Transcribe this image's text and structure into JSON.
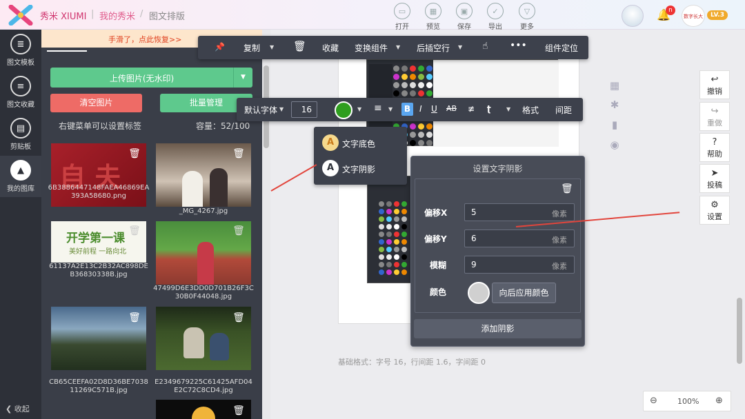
{
  "header": {
    "brand": "秀米 XIUMI",
    "breadcrumb": [
      "我的秀米",
      "图文排版"
    ],
    "toolbar": [
      {
        "label": "打开",
        "icon": "folder-icon"
      },
      {
        "label": "预览",
        "icon": "preview-icon"
      },
      {
        "label": "保存",
        "icon": "save-icon"
      },
      {
        "label": "导出",
        "icon": "export-icon"
      },
      {
        "label": "更多",
        "icon": "more-icon"
      }
    ],
    "notification_count": "n",
    "badge_text": "数字长大",
    "level": "LV.3"
  },
  "leftnav": {
    "items": [
      {
        "label": "图文模板",
        "icon": "template-icon"
      },
      {
        "label": "图文收藏",
        "icon": "favorites-icon"
      },
      {
        "label": "剪贴板",
        "icon": "clipboard-icon"
      },
      {
        "label": "我的图库",
        "icon": "gallery-icon"
      }
    ],
    "collapse": "收起",
    "collapse_arrow": "❮"
  },
  "panel": {
    "hint": "手滑了，点此恢复>>",
    "upload_label": "上传图片(无水印)",
    "clear_label": "清空图片",
    "batch_label": "批量管理",
    "tip": "右键菜单可以设置标签",
    "capacity": "容量：52/100",
    "images": [
      {
        "caption": "6B3886447148FAEA46869EA393A58680.png"
      },
      {
        "caption": "_MG_4267.jpg"
      },
      {
        "caption": "61137A2E13C2B32AC898DEB36830338B.jpg"
      },
      {
        "caption": "47499D6E3DD0D701B26F3C30B0F44048.jpg"
      },
      {
        "caption": "CB65CEEFA02D8D36BE703811269C571B.jpg"
      },
      {
        "caption": "E2349679225C61425AFD04E2C72C8CD4.jpg"
      }
    ],
    "thumb_text_1": "开学第一课",
    "thumb_text_2": "美好前程 一路向北"
  },
  "toolbar_top": {
    "pin": "📌",
    "copy": "复制",
    "delete": "🗑",
    "favorite": "收藏",
    "transform": "变换组件",
    "insert_after": "后插空行",
    "more": "•••",
    "locate": "组件定位"
  },
  "toolbar_text": {
    "font": "默认字体",
    "size": "16",
    "bold": "B",
    "italic": "I",
    "underline": "U",
    "strike": "AB",
    "clear": "Ɐ",
    "format": "格式",
    "spacing": "间距",
    "color": "#2f9e1f"
  },
  "context_menu": {
    "items": [
      {
        "label": "文字底色",
        "icon": "A"
      },
      {
        "label": "文字阴影",
        "icon": "A"
      }
    ]
  },
  "shadow_panel": {
    "title": "设置文字阴影",
    "fields": [
      {
        "label": "偏移X",
        "value": "5",
        "unit": "像素"
      },
      {
        "label": "偏移Y",
        "value": "6",
        "unit": "像素"
      },
      {
        "label": "模糊",
        "value": "9",
        "unit": "像素"
      }
    ],
    "color_label": "颜色",
    "apply_color": "向后应用颜色",
    "add_shadow": "添加阴影"
  },
  "canvas": {
    "base_format": "基础格式：字号 16，行间距 1.6，字间距 0"
  },
  "right_panel": {
    "buttons": [
      {
        "label": "撤销",
        "icon": "↩"
      },
      {
        "label": "重做",
        "icon": "↪"
      },
      {
        "label": "帮助",
        "icon": "?"
      },
      {
        "label": "投稿",
        "icon": "➤"
      },
      {
        "label": "设置",
        "icon": "⚙"
      }
    ]
  },
  "zoom": {
    "value": "100%",
    "minus": "−",
    "plus": "+"
  }
}
